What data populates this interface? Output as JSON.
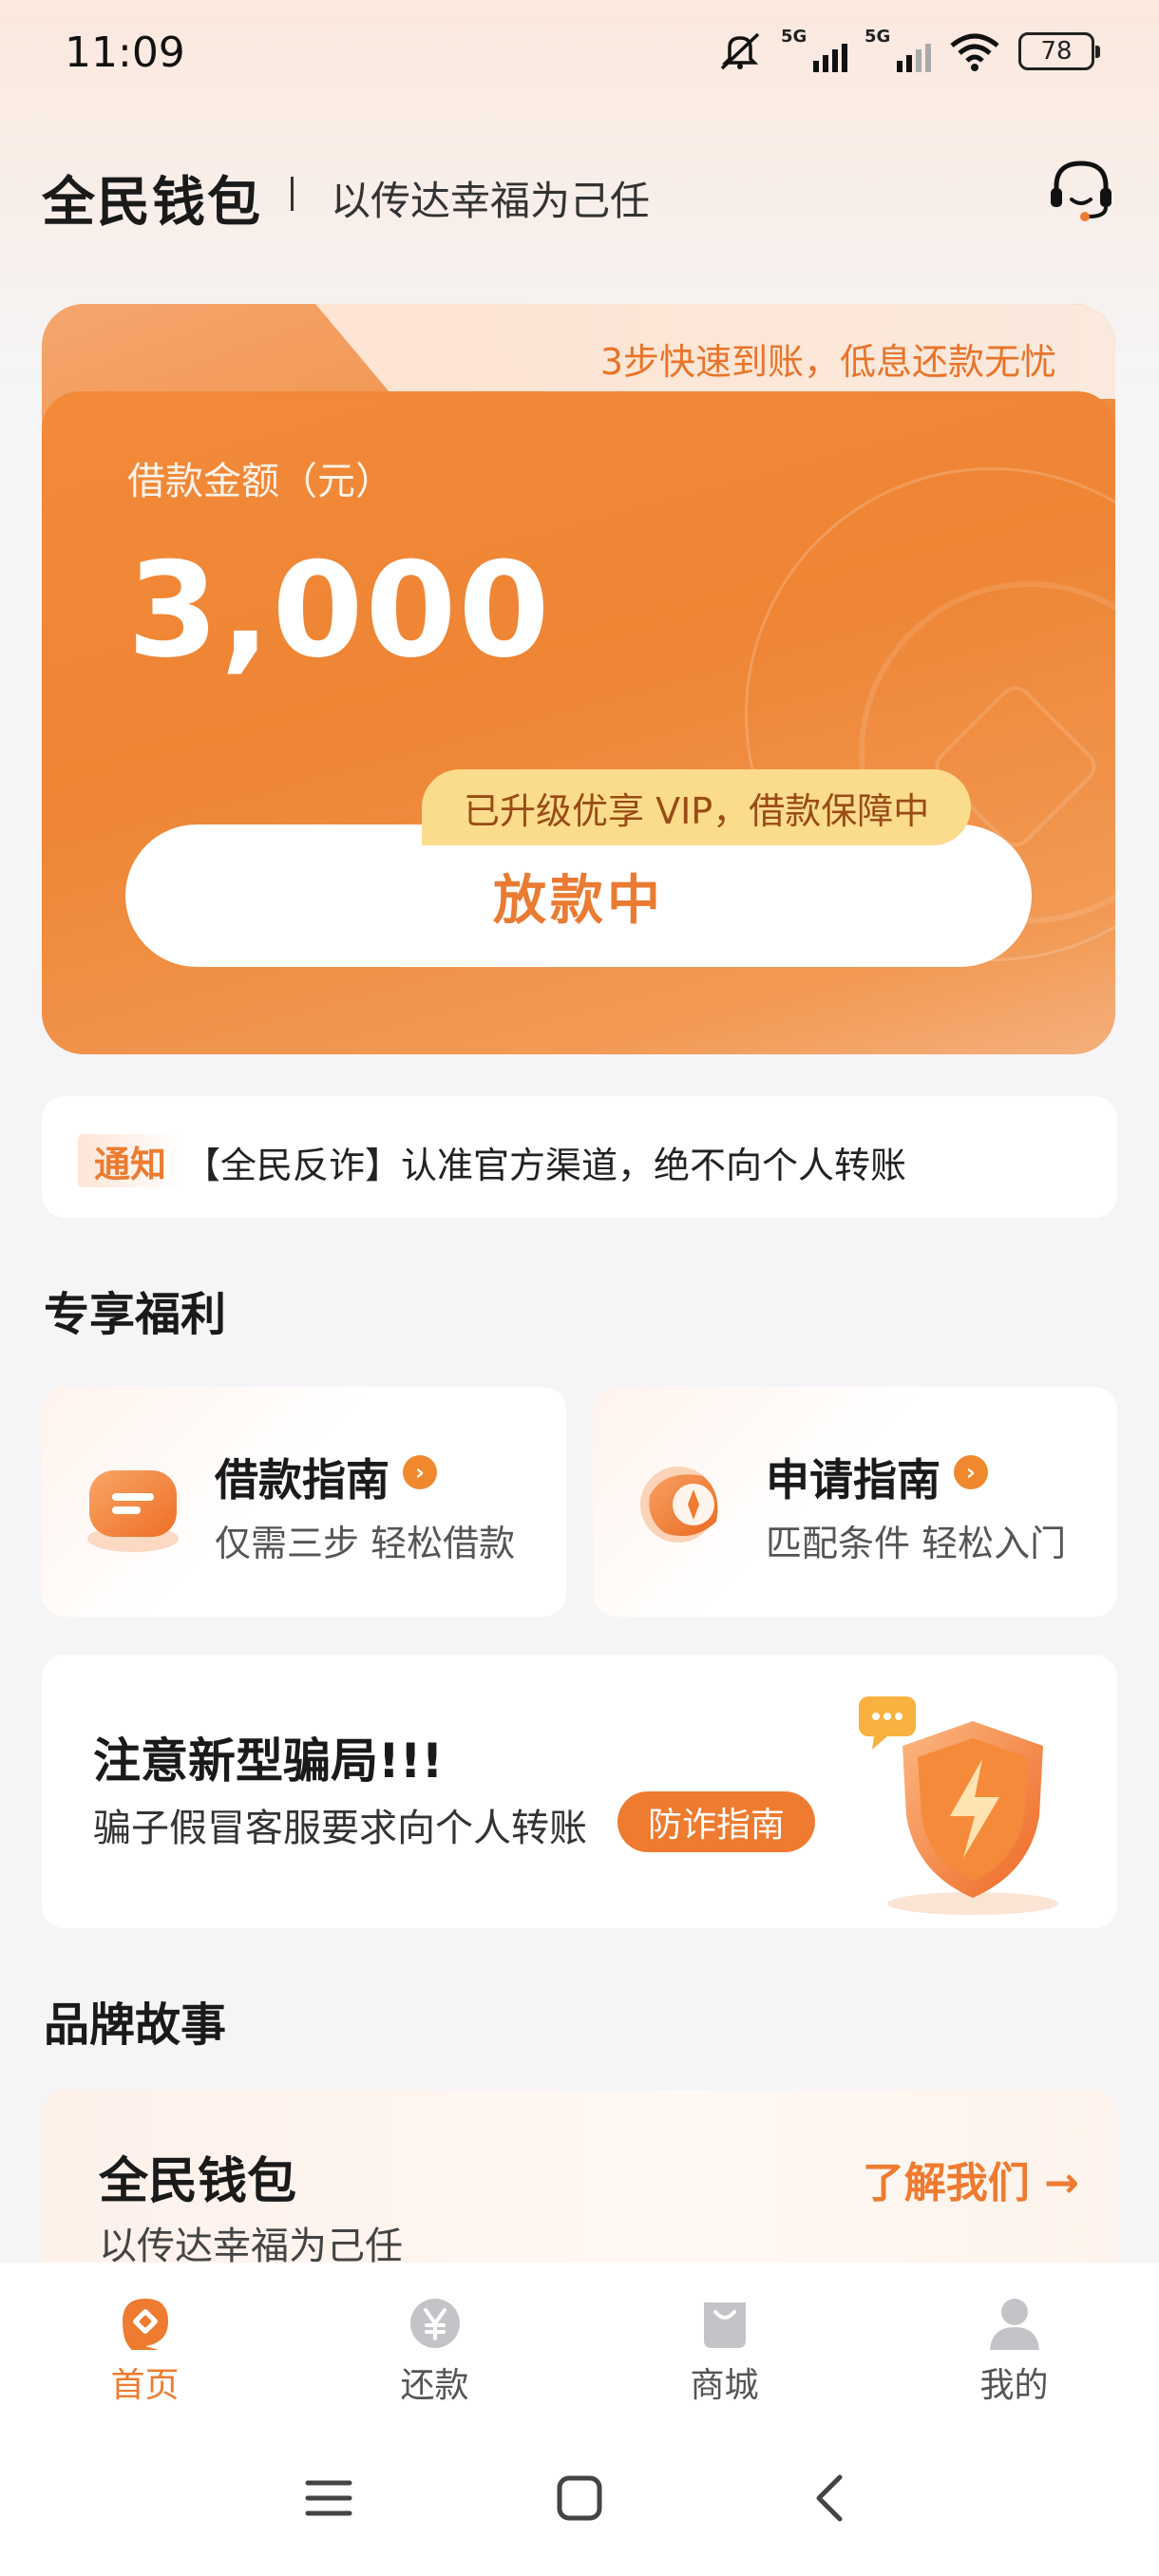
{
  "status_bar": {
    "time": "11:09",
    "signal1_label": "5G",
    "signal2_label": "5G",
    "battery": "78"
  },
  "header": {
    "brand": "全民钱包",
    "slogan": "以传达幸福为己任",
    "cs_icon": "headset-icon"
  },
  "loan_card": {
    "tab_text": "3步快速到账，低息还款无忧",
    "amount_label": "借款金额（元）",
    "amount": "3,000",
    "vip_text": "已升级优享 VIP，借款保障中",
    "status_button": "放款中"
  },
  "notice": {
    "tag": "通知",
    "text": "【全民反诈】认准官方渠道，绝不向个人转账"
  },
  "benefits": {
    "title": "专享福利",
    "cards": [
      {
        "title": "借款指南",
        "subtitle": "仅需三步 轻松借款",
        "icon": "wallet-icon"
      },
      {
        "title": "申请指南",
        "subtitle": "匹配条件 轻松入门",
        "icon": "compass-icon"
      }
    ]
  },
  "fraud": {
    "title": "注意新型骗局!!!",
    "desc": "骗子假冒客服要求向个人转账",
    "button": "防诈指南",
    "icon": "shield-lightning-icon"
  },
  "brand_story": {
    "section_title": "品牌故事",
    "title": "全民钱包",
    "subtitle": "以传达幸福为己任",
    "link": "了解我们 →"
  },
  "tabs": [
    {
      "label": "首页",
      "icon": "home-icon",
      "active": true
    },
    {
      "label": "还款",
      "icon": "yen-icon",
      "active": false
    },
    {
      "label": "商城",
      "icon": "shopping-bag-icon",
      "active": false
    },
    {
      "label": "我的",
      "icon": "profile-icon",
      "active": false
    }
  ],
  "colors": {
    "accent": "#ee7b30",
    "card_orange": "#f28a3a",
    "vip_yellow": "#fbdc8d"
  }
}
